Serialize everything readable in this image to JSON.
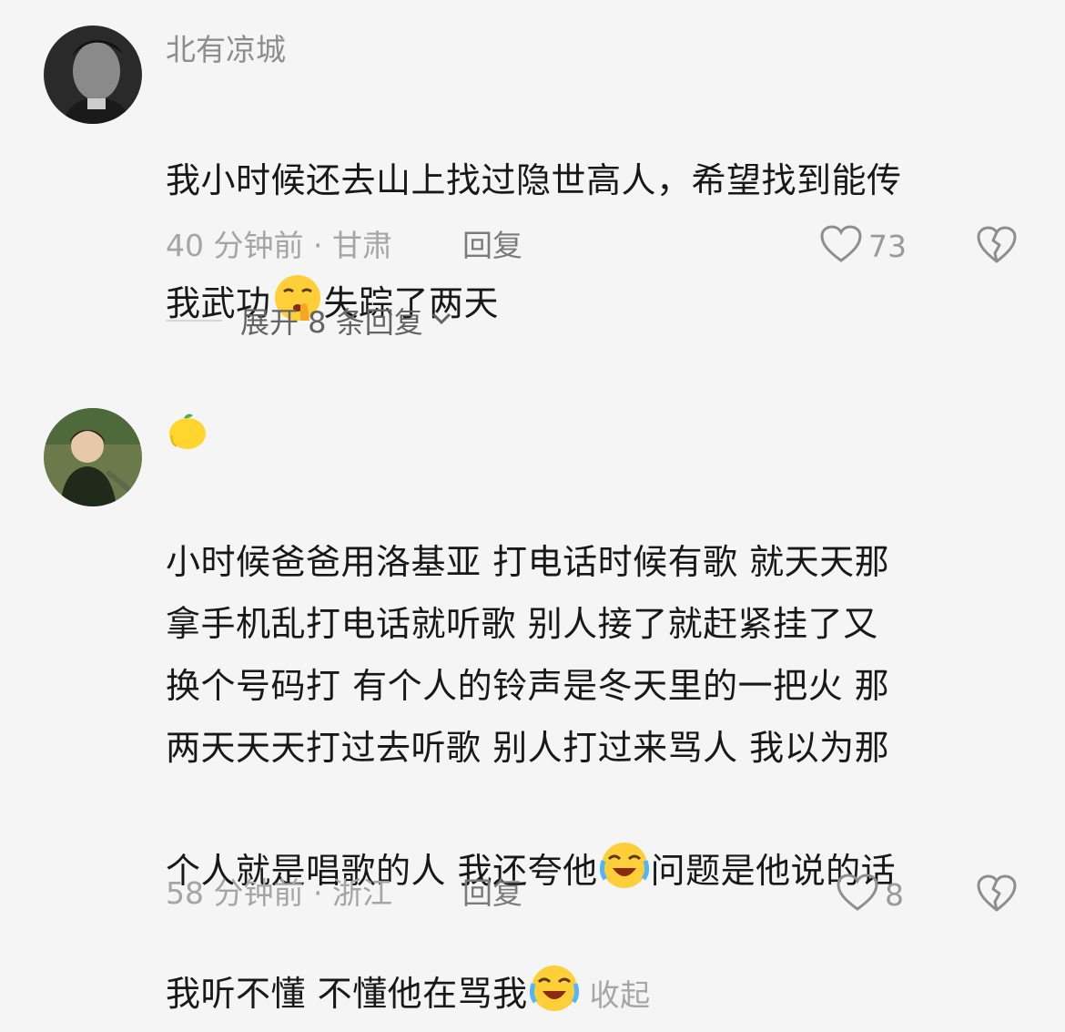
{
  "comments": [
    {
      "username": "北有凉城",
      "text_before_emoji": "我小时候还去山上找过隐世高人，希望找到能传\n我武功",
      "text_after_emoji": "失踪了两天",
      "emoji": "shush-emoji",
      "time_location": "40 分钟前 · 甘肃",
      "reply_label": "回复",
      "likes": "73",
      "expand_label": "展开 8 条回复"
    },
    {
      "username_emoji": "lemon-emoji",
      "text_1": "小时候爸爸用洛基亚 打电话时候有歌 就天天那\n拿手机乱打电话就听歌 别人接了就赶紧挂了又\n换个号码打 有个人的铃声是冬天里的一把火 那\n两天天天打过去听歌 别人打过来骂人 我以为那\n个人就是唱歌的人 我还夸他",
      "text_2": "问题是他说的话\n我听不懂 不懂他在骂我",
      "emoji_1": "laughing-cry-emoji",
      "emoji_2": "laughing-cry-emoji",
      "collapse_label": "收起",
      "time_location": "58 分钟前 · 浙江",
      "reply_label": "回复",
      "likes": "8"
    }
  ],
  "colors": {
    "background": "#f5f5f5",
    "text": "#181818",
    "meta": "#a5a5a5"
  }
}
